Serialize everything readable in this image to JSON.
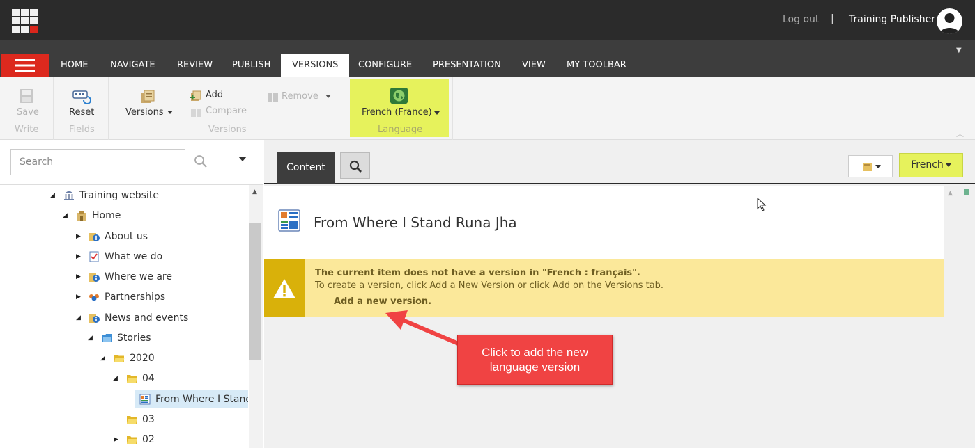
{
  "topbar": {
    "logout": "Log out",
    "separator": "|",
    "user": "Training Publisher"
  },
  "menu": {
    "tabs": [
      "HOME",
      "NAVIGATE",
      "REVIEW",
      "PUBLISH",
      "VERSIONS",
      "CONFIGURE",
      "PRESENTATION",
      "VIEW",
      "MY TOOLBAR"
    ],
    "active": "VERSIONS"
  },
  "ribbon": {
    "save": "Save",
    "write_group": "Write",
    "reset": "Reset",
    "fields_group": "Fields",
    "versions": "Versions",
    "add": "Add",
    "compare": "Compare",
    "remove": "Remove",
    "versions_group": "Versions",
    "language": "French (France)",
    "language_group": "Language"
  },
  "search": {
    "placeholder": "Search"
  },
  "tree": [
    {
      "label": "Training website",
      "icon": "website-icon"
    },
    {
      "label": "Home",
      "icon": "home-icon"
    },
    {
      "label": "About us",
      "icon": "page-info-icon"
    },
    {
      "label": "What we do",
      "icon": "checklist-icon"
    },
    {
      "label": "Where we are",
      "icon": "page-info-icon"
    },
    {
      "label": "Partnerships",
      "icon": "people-icon"
    },
    {
      "label": "News and events",
      "icon": "page-info-icon"
    },
    {
      "label": "Stories",
      "icon": "stories-folder-icon"
    },
    {
      "label": "2020",
      "icon": "folder-icon"
    },
    {
      "label": "04",
      "icon": "folder-icon"
    },
    {
      "label": "From Where I Stand R",
      "icon": "article-icon"
    },
    {
      "label": "03",
      "icon": "folder-icon"
    },
    {
      "label": "02",
      "icon": "folder-icon"
    }
  ],
  "content": {
    "tab_content": "Content",
    "language_button": "French",
    "item_title": "From Where I Stand Runa Jha",
    "warning_title": "The current item does not have a version in \"French : français\".",
    "warning_text": "To create a version, click Add a New Version or click Add on the Versions tab.",
    "warning_link": "Add a new version."
  },
  "annotation": {
    "line1": "Click to add the new",
    "line2": "language version"
  },
  "colors": {
    "highlight": "#e6f25c",
    "accent_red": "#dc291e",
    "warning_bg": "#fbe89a",
    "warning_icon_bg": "#d9b10a",
    "callout": "#f04343"
  }
}
